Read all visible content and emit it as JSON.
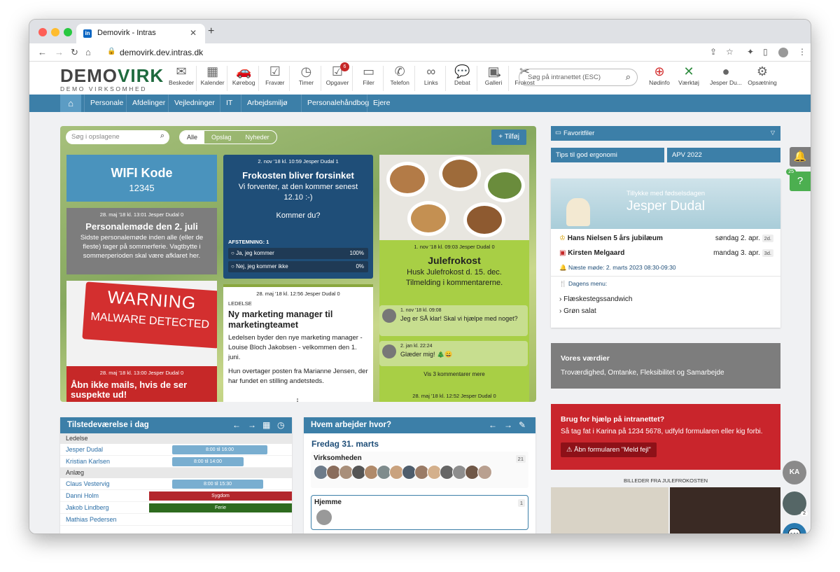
{
  "browser": {
    "tab_title": "Demovirk - Intras",
    "url": "demovirk.dev.intras.dk"
  },
  "logo": {
    "main": "DEMO",
    "accent": "VIRK",
    "sub": "DEMO VIRKSOMHED"
  },
  "toolbar": [
    {
      "label": "Beskeder",
      "icon": "✉"
    },
    {
      "label": "Kalender",
      "icon": "▦"
    },
    {
      "label": "Kørebog",
      "icon": "🚗"
    },
    {
      "label": "Fravær",
      "icon": "☑"
    },
    {
      "label": "Timer",
      "icon": "◷"
    },
    {
      "label": "Opgaver",
      "icon": "☑",
      "badge": "6"
    },
    {
      "label": "Filer",
      "icon": "▭"
    },
    {
      "label": "Telefon",
      "icon": "✆"
    },
    {
      "label": "Links",
      "icon": "∞"
    },
    {
      "label": "Debat",
      "icon": "💬"
    },
    {
      "label": "Galleri",
      "icon": "▣"
    },
    {
      "label": "Frokost",
      "icon": "✂"
    }
  ],
  "search_placeholder": "Søg på intranettet (ESC)",
  "right_tools": [
    {
      "label": "Nødinfo",
      "icon": "⊕"
    },
    {
      "label": "Værktøj",
      "icon": "✕"
    },
    {
      "label": "Jesper Du...",
      "icon": "●"
    },
    {
      "label": "Opsætning",
      "icon": "⚙"
    }
  ],
  "nav": [
    "Personale",
    "Afdelinger",
    "Vejledninger",
    "IT",
    "Arbejdsmiljø",
    "Personalehåndbog",
    "Ejere"
  ],
  "board": {
    "search_placeholder": "Søg i opslagene",
    "filters": [
      "Alle",
      "Opslag",
      "Nyheder"
    ],
    "add": "+ Tilføj",
    "wifi": {
      "title": "WIFI Kode",
      "code": "12345"
    },
    "meeting": {
      "meta": "28. maj '18 kl. 13:01  Jesper Dudal  0",
      "title": "Personalemøde den 2. juli",
      "body": "Sidste personalemøde inden alle (eller de fleste) tager på sommerferie. Vagtbytte i sommerperioden skal være afklaret her."
    },
    "warning": {
      "line1": "WARNING",
      "line2": "MALWARE DETECTED",
      "meta": "28. maj '18 kl. 13:00  Jesper Dudal  0",
      "title": "Åbn ikke mails, hvis de ser suspekte ud!"
    },
    "lunch": {
      "meta": "2. nov '18 kl. 10:59  Jesper Dudal  1",
      "title": "Frokosten bliver forsinket",
      "body": "Vi forventer, at den kommer senest 12.10 :-)",
      "question": "Kommer du?",
      "poll_label": "AFSTEMNING:  1",
      "opt1": "Ja, jeg kommer",
      "pct1": "100%",
      "opt2": "Nej, jeg kommer ikke",
      "pct2": "0%"
    },
    "hire": {
      "meta": "28. maj '18 kl. 12:56  Jesper Dudal  0",
      "category": "LEDELSE",
      "title": "Ny marketing manager til marketingteamet",
      "body1": "Ledelsen byder den nye marketing manager - Louise Bloch Jakobsen - velkommen den 1. juni.",
      "body2": "Hun overtager posten fra Marianne Jensen, der har fundet en stilling andetsteds."
    },
    "xmas": {
      "meta": "1. nov '18 kl. 09:03  Jesper Dudal  0",
      "title": "Julefrokost",
      "body": "Husk Julefrokost d. 15. dec. Tilmelding i kommentarerne.",
      "c1_meta": "1. nov '18 kl. 09:08",
      "c1": "Jeg er SÅ klar! Skal vi hjælpe med noget?",
      "c2_meta": "2. jan kl. 22:24",
      "c2": "Glæder mig! 🎄😀",
      "more": "Vis 3 kommentarer mere",
      "next_meta": "28. maj '18 kl. 12:52  Jesper Dudal  0"
    }
  },
  "right": {
    "favorites": "Favoritfiler",
    "chips": [
      "Tips til god ergonomi",
      "APV 2022"
    ],
    "bday_l1": "Tillykke med fødselsdagen",
    "bday_name": "Jesper Dudal",
    "events": [
      {
        "name": "Hans Nielsen 5 års jubilæum",
        "date": "søndag 2. apr.",
        "tag": "2d."
      },
      {
        "name": "Kirsten Melgaard",
        "date": "mandag 3. apr.",
        "tag": "3d."
      }
    ],
    "next_meeting": "Næste møde: 2. marts 2023  08:30-09:30",
    "menu_title": "Dagens menu:",
    "menu": [
      "Flæskestegssandwich",
      "Grøn salat"
    ],
    "values_title": "Vores værdier",
    "values_body": "Troværdighed, Omtanke, Fleksibilitet og Samarbejde",
    "help_title": "Brug for hjælp på intranettet?",
    "help_body": "Så tag fat i Karina på 1234 5678, udfyld formularen eller kig forbi.",
    "help_btn": "Åbn formularen \"Meld fejl\"",
    "pics_title": "BILLEDER FRA JULEFROKOSTEN"
  },
  "presence": {
    "title": "Tilstedeværelse i dag",
    "groups": [
      {
        "name": "Ledelse",
        "people": [
          {
            "name": "Jesper Dudal",
            "bar": "8:00 til 16:00",
            "kind": "work"
          },
          {
            "name": "Kristian Karlsen",
            "bar": "8:00 til 14:00",
            "kind": "work"
          }
        ]
      },
      {
        "name": "Anlæg",
        "people": [
          {
            "name": "Claus Vestervig",
            "bar": "8:00 til 15:30",
            "kind": "work"
          },
          {
            "name": "Danni Holm",
            "bar": "Sygdom",
            "kind": "sick"
          },
          {
            "name": "Jakob Lindberg",
            "bar": "Ferie",
            "kind": "vac"
          },
          {
            "name": "Mathias Pedersen",
            "bar": "",
            "kind": "none"
          }
        ]
      }
    ]
  },
  "where": {
    "title": "Hvem arbejder hvor?",
    "date": "Fredag 31. marts",
    "loc1": "Virksomheden",
    "loc1_count": "21",
    "loc2": "Hjemme",
    "loc2_count": "1"
  },
  "sidebar": {
    "chat_count": "25",
    "ka": "KA",
    "count2": "2"
  }
}
